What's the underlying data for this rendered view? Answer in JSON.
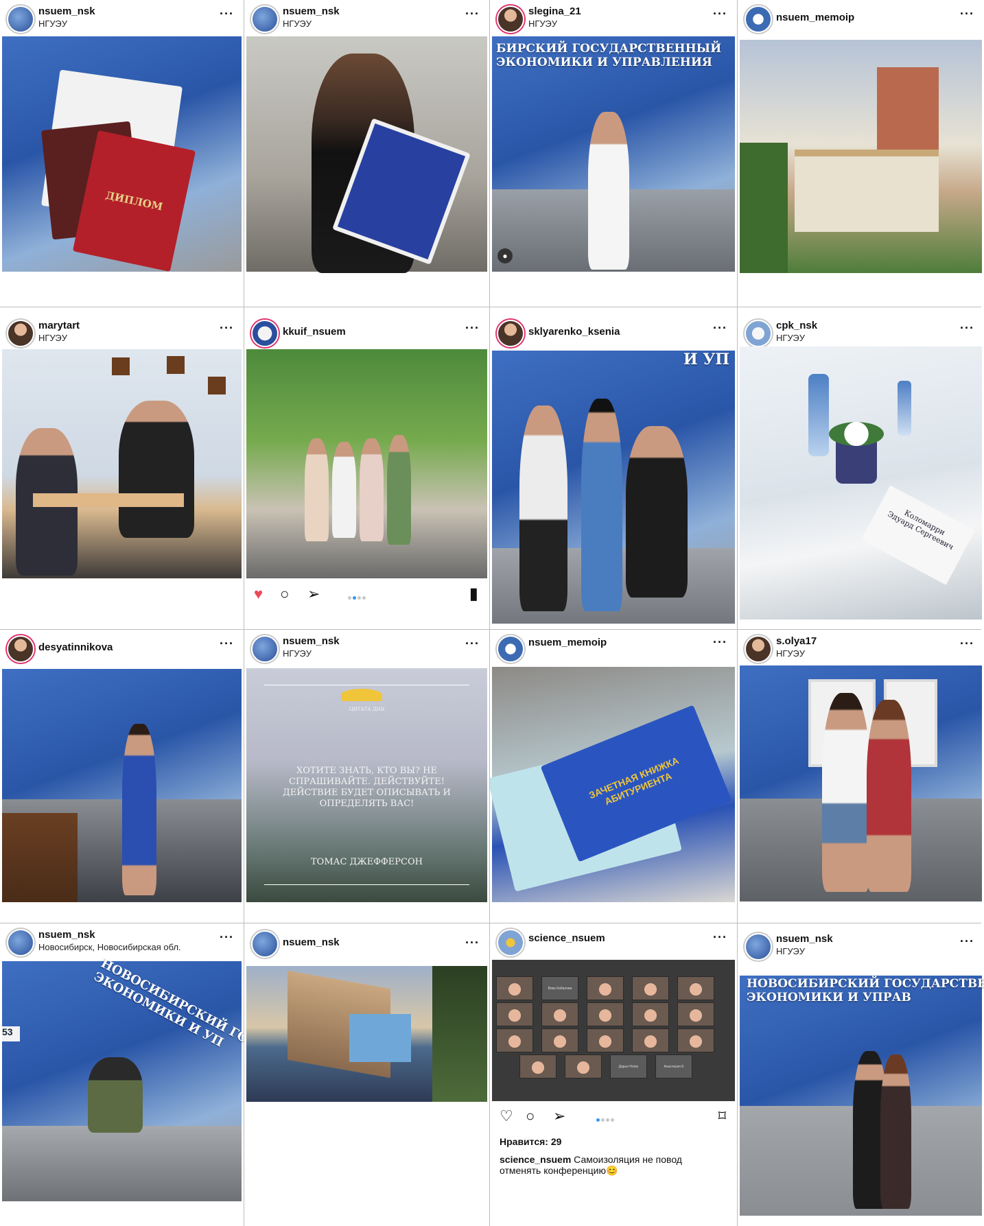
{
  "colors": {
    "like_red": "#ed4956",
    "dot_active": "#3897f0",
    "grid_line": "#bdbdbd"
  },
  "icons": {
    "more": "more-dots-icon",
    "heart": "heart-icon",
    "comment": "comment-icon",
    "share": "send-icon",
    "save": "bookmark-icon"
  },
  "posts": [
    {
      "username": "nsuem_nsk",
      "location": "НГУЭУ",
      "more": "···",
      "photo": "diploma-photo",
      "doc_text": "ДИПЛОМ"
    },
    {
      "username": "nsuem_nsk",
      "location": "НГУЭУ",
      "more": "···",
      "photo": "girl-mask-diploma-photo"
    },
    {
      "username": "slegina_21",
      "location": "НГУЭУ",
      "more": "···",
      "photo": "graduate-cap-photo",
      "sign_text": "БИРСКИЙ ГОСУДАРСТВЕННЫЙ\nЭКОНОМИКИ И УПРАВЛЕНИЯ"
    },
    {
      "username": "nsuem_memoip",
      "more": "···",
      "photo": "campus-building-photo"
    },
    {
      "username": "marytart",
      "location": "НГУЭУ",
      "more": "···",
      "photo": "interview-photo"
    },
    {
      "username": "kkuif_nsuem",
      "more": "···",
      "photo": "park-graduates-photo",
      "liked": true,
      "dots_total": 3,
      "dots_active": 1
    },
    {
      "username": "sklyarenko_ksenia",
      "more": "···",
      "photo": "three-friends-photo",
      "sign_text": "И УП"
    },
    {
      "username": "cpk_nsk",
      "location": "НГУЭУ",
      "more": "···",
      "photo": "conference-table-photo",
      "card_text": "Коломарри\nЭдуард Сергеевич"
    },
    {
      "username": "desyatinnikova",
      "more": "···",
      "photo": "woman-blue-dress-photo"
    },
    {
      "username": "nsuem_nsk",
      "location": "НГУЭУ",
      "more": "···",
      "photo": "quote-mountains-photo",
      "quote_small": "ЦИТАТА ДНЯ",
      "quote": "ХОТИТЕ ЗНАТЬ, КТО ВЫ? НЕ СПРАШИВАЙТЕ. ДЕЙСТВУЙТЕ! ДЕЙСТВИЕ БУДЕТ ОПИСЫВАТЬ И ОПРЕДЕЛЯТЬ ВАС!",
      "author": "ТОМАС ДЖЕФФЕРСОН"
    },
    {
      "username": "nsuem_memoip",
      "more": "···",
      "photo": "record-book-photo",
      "book_text": "ЗАЧЕТНАЯ КНИЖКА\nАБИТУРИЕНТА"
    },
    {
      "username": "s.olya17",
      "location": "НГУЭУ",
      "more": "···",
      "photo": "couple-kiss-photo"
    },
    {
      "username": "nsuem_nsk",
      "location": "Новосибирск, Новосибирская обл.",
      "more": "···",
      "photo": "helmet-rider-photo",
      "sign_text": "НОВОСИБИРСКИЙ ГОСУДАРСТ\nЭКОНОМИКИ И УП",
      "house_number": "53"
    },
    {
      "username": "nsuem_nsk",
      "more": "···",
      "photo": "university-panorama-photo"
    },
    {
      "username": "science_nsuem",
      "more": "···",
      "photo": "video-conference-photo",
      "dots_total": 4,
      "dots_active": 0,
      "likes": "Нравится: 29",
      "caption_user": "science_nsuem",
      "caption_text": " Самоизоляция не повод отменять конференцию😊",
      "tile_names": [
        "Вика Кабанова",
        "Дарья Нолю",
        "Анастасия Е"
      ]
    },
    {
      "username": "nsuem_nsk",
      "location": "НГУЭУ",
      "more": "···",
      "photo": "couple-diploma-photo",
      "sign_text": "НОВОСИБИРСКИЙ ГОСУДАРСТВЕНН\nЭКОНОМИКИ И УПРАВ"
    }
  ]
}
